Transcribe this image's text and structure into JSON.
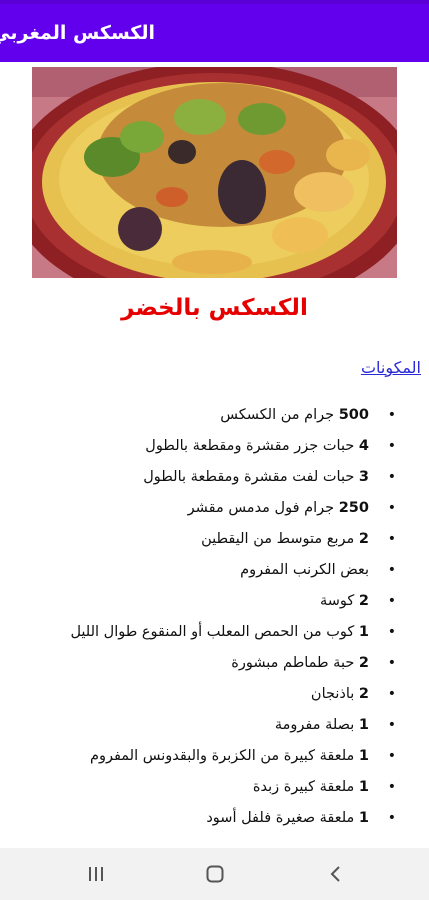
{
  "app_bar": {
    "title": "الكسكس المغربي",
    "color": "#6200ee"
  },
  "dish": {
    "photo_icon": "couscous-with-vegetables-photo",
    "title": "الكسكس بالخضر",
    "title_color": "#e60000"
  },
  "ingredients_link": "المكونات",
  "ingredients": [
    {
      "qty": "500",
      "text": " جرام من الكسكس"
    },
    {
      "qty": "4",
      "text": " حبات جزر مقشرة ومقطعة بالطول"
    },
    {
      "qty": "3",
      "text": " حبات لفت مقشرة ومقطعة بالطول"
    },
    {
      "qty": "250",
      "text": " جرام فول مدمس مقشر"
    },
    {
      "qty": "2",
      "text": " مربع متوسط من اليقطين"
    },
    {
      "qty": "",
      "text": "بعض الكرنب المفروم"
    },
    {
      "qty": "2",
      "text": " كوسة"
    },
    {
      "qty": "1",
      "text": " كوب من الحمص المعلب أو المنقوع طوال الليل"
    },
    {
      "qty": "2",
      "text": " حبة طماطم مبشورة"
    },
    {
      "qty": "2",
      "text": " باذنجان"
    },
    {
      "qty": "1",
      "text": " بصلة مفرومة"
    },
    {
      "qty": "1",
      "text": " ملعقة كبيرة من الكزبرة والبقدونس المفروم"
    },
    {
      "qty": "1",
      "text": " ملعقة كبيرة زبدة"
    },
    {
      "qty": "1",
      "text": " ملعقة صغيرة فلفل أسود"
    }
  ],
  "nav_bar": {
    "recents_icon": "recents-icon",
    "home_icon": "home-icon",
    "back_icon": "back-icon"
  }
}
